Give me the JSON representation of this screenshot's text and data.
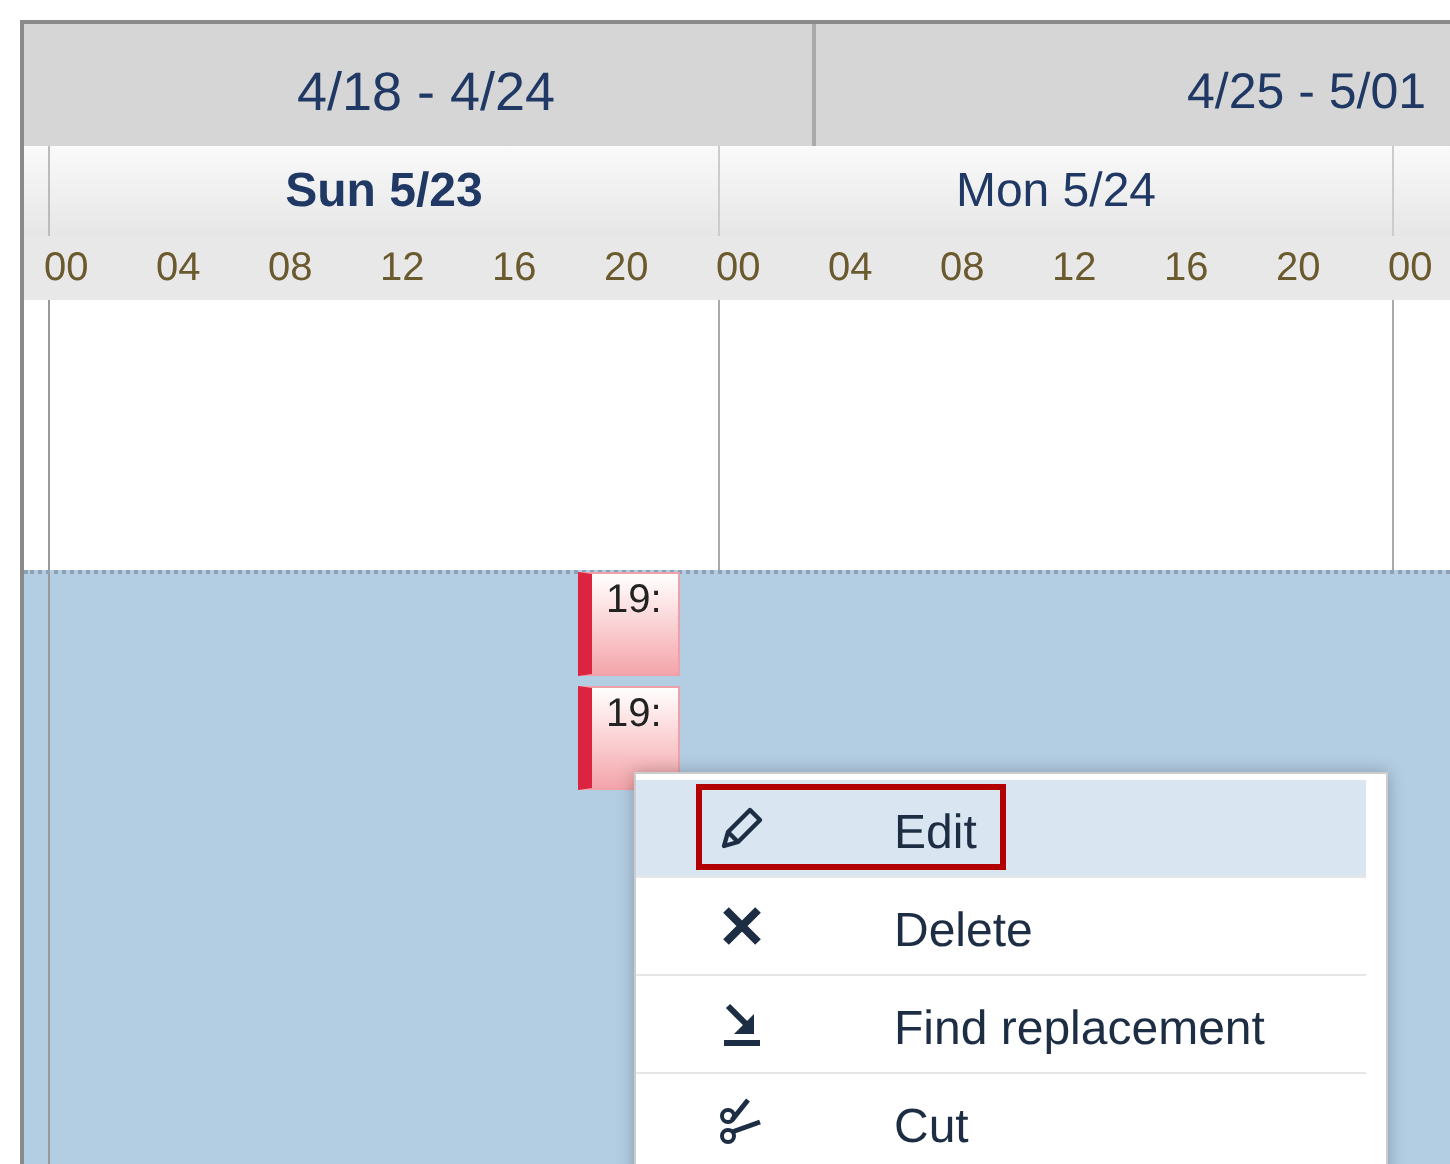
{
  "weeks": [
    {
      "label": "4/18 - 4/24"
    },
    {
      "label": "4/25 - 5/01"
    }
  ],
  "days": [
    {
      "label": "Sun 5/23",
      "selected": true
    },
    {
      "label": "Mon 5/24",
      "selected": false
    }
  ],
  "hours": [
    "00",
    "04",
    "08",
    "12",
    "16",
    "20",
    "00",
    "04",
    "08",
    "12",
    "16",
    "20",
    "00"
  ],
  "events": [
    {
      "text": "19:"
    },
    {
      "text": "19:"
    }
  ],
  "context_menu": {
    "items": [
      {
        "label": "Edit",
        "kind": "edit",
        "selected": true
      },
      {
        "label": "Delete",
        "kind": "delete",
        "selected": false
      },
      {
        "label": "Find replacement",
        "kind": "replace",
        "selected": false
      },
      {
        "label": "Cut",
        "kind": "cut",
        "selected": false
      }
    ]
  }
}
